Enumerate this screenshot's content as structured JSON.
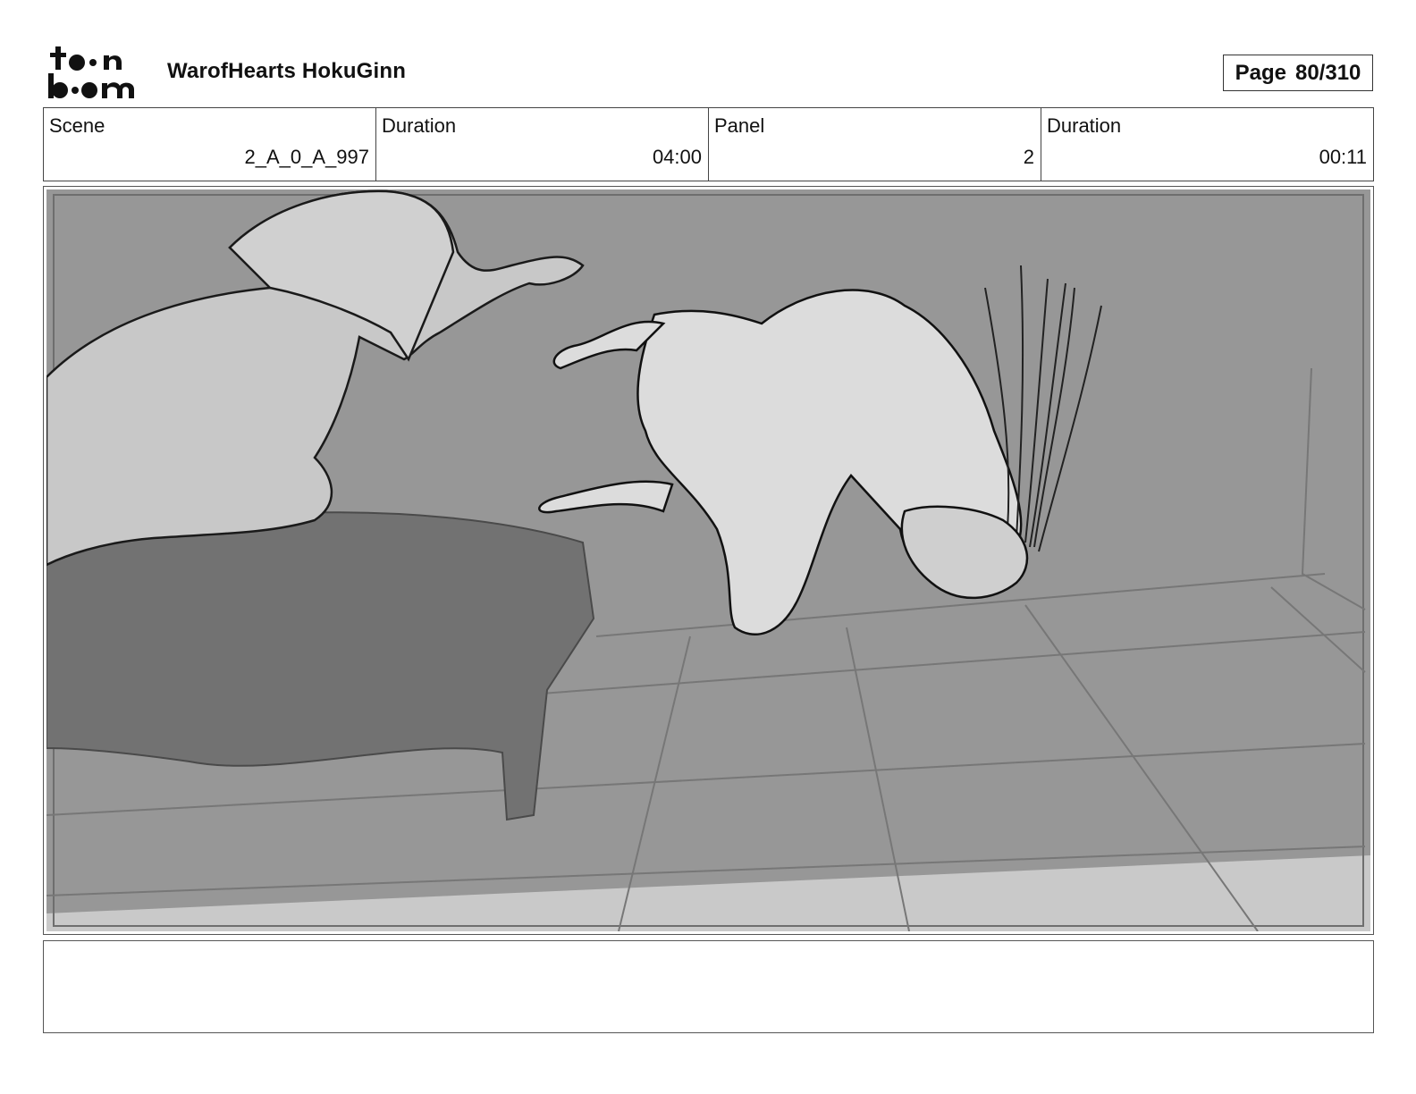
{
  "header": {
    "logo_text": "toon boom",
    "project_title": "WarofHearts HokuGinn",
    "page_label": "Page",
    "page_number": "80/310"
  },
  "info": {
    "scene_label": "Scene",
    "scene_value": "2_A_0_A_997",
    "scene_duration_label": "Duration",
    "scene_duration_value": "04:00",
    "panel_label": "Panel",
    "panel_value": "2",
    "panel_duration_label": "Duration",
    "panel_duration_value": "00:11"
  },
  "notes": {
    "text": ""
  }
}
